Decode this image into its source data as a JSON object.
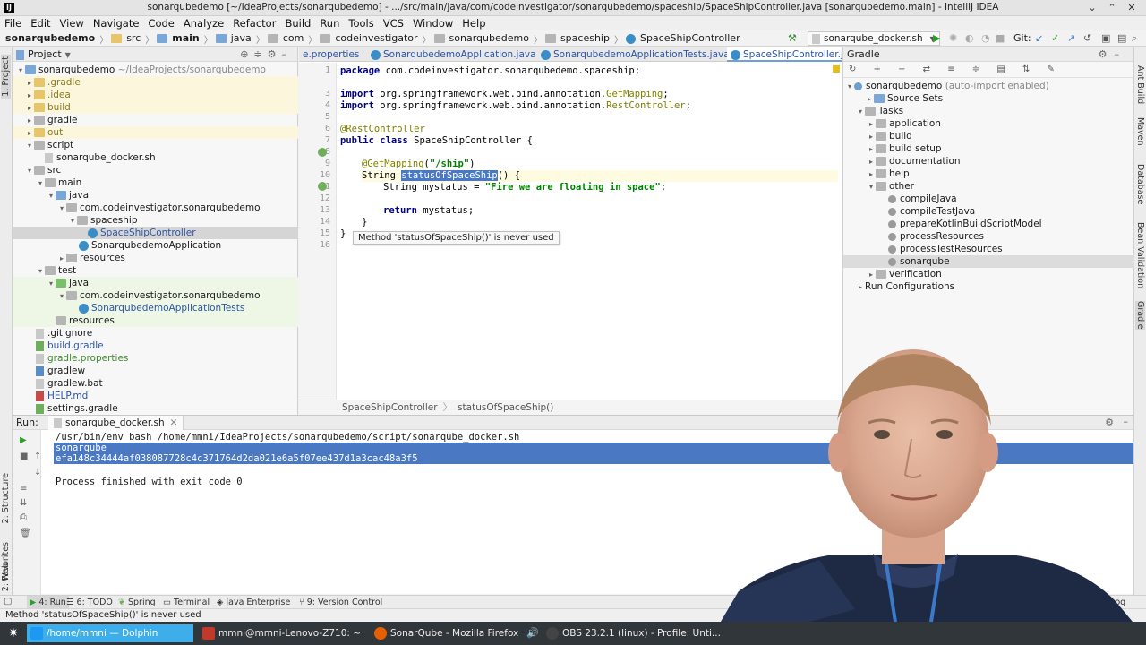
{
  "window": {
    "title": "sonarqubedemo [~/IdeaProjects/sonarqubedemo] - .../src/main/java/com/codeinvestigator/sonarqubedemo/spaceship/SpaceShipController.java [sonarqubedemo.main] - IntelliJ IDEA"
  },
  "menu": [
    "File",
    "Edit",
    "View",
    "Navigate",
    "Code",
    "Analyze",
    "Refactor",
    "Build",
    "Run",
    "Tools",
    "VCS",
    "Window",
    "Help"
  ],
  "breadcrumb": [
    "sonarqubedemo",
    "src",
    "main",
    "java",
    "com",
    "codeinvestigator",
    "sonarqubedemo",
    "spaceship",
    "SpaceShipController"
  ],
  "run_config": "sonarqube_docker.sh",
  "vcs_label": "Git:",
  "project_panel": {
    "title": "Project",
    "tree": [
      {
        "label": "sonarqubedemo",
        "suffix": "~/IdeaProjects/sonarqubedemo",
        "arrow": "▾"
      },
      {
        "label": ".gradle",
        "arrow": "▸"
      },
      {
        "label": ".idea",
        "arrow": "▸"
      },
      {
        "label": "build",
        "arrow": "▸"
      },
      {
        "label": "gradle",
        "arrow": "▸"
      },
      {
        "label": "out",
        "arrow": "▸"
      },
      {
        "label": "script",
        "arrow": "▾"
      },
      {
        "label": "sonarqube_docker.sh",
        "arrow": ""
      },
      {
        "label": "src",
        "arrow": "▾"
      },
      {
        "label": "main",
        "arrow": "▾"
      },
      {
        "label": "java",
        "arrow": "▾"
      },
      {
        "label": "com.codeinvestigator.sonarqubedemo",
        "arrow": "▾"
      },
      {
        "label": "spaceship",
        "arrow": "▾"
      },
      {
        "label": "SpaceShipController",
        "arrow": ""
      },
      {
        "label": "SonarqubedemoApplication",
        "arrow": ""
      },
      {
        "label": "resources",
        "arrow": "▸"
      },
      {
        "label": "test",
        "arrow": "▾"
      },
      {
        "label": "java",
        "arrow": "▾"
      },
      {
        "label": "com.codeinvestigator.sonarqubedemo",
        "arrow": "▾"
      },
      {
        "label": "SonarqubedemoApplicationTests",
        "arrow": ""
      },
      {
        "label": "resources",
        "arrow": ""
      },
      {
        "label": ".gitignore",
        "arrow": ""
      },
      {
        "label": "build.gradle",
        "arrow": ""
      },
      {
        "label": "gradle.properties",
        "arrow": ""
      },
      {
        "label": "gradlew",
        "arrow": ""
      },
      {
        "label": "gradlew.bat",
        "arrow": ""
      },
      {
        "label": "HELP.md",
        "arrow": ""
      },
      {
        "label": "settings.gradle",
        "arrow": ""
      }
    ]
  },
  "editor": {
    "tabs": [
      "e.properties",
      "SonarqubedemoApplication.java",
      "SonarqubedemoApplicationTests.java",
      "SpaceShipController.ja"
    ],
    "line_numbers": [
      "1",
      "3",
      "4",
      "5",
      "6",
      "7",
      "8",
      "9",
      "10",
      "11",
      "12",
      "13",
      "14",
      "15",
      "16"
    ],
    "code": {
      "l1_kw": "package",
      "l1_rest": " com.codeinvestigator.sonarqubedemo.spaceship;",
      "l3_kw": "import",
      "l3_a": " org.springframework.web.bind.annotation.",
      "l3_b": "GetMapping",
      "l3_c": ";",
      "l4_kw": "import",
      "l4_a": " org.springframework.web.bind.annotation.",
      "l4_b": "RestController",
      "l4_c": ";",
      "l6_an": "@RestController",
      "l7_kw1": "public class",
      "l7_rest": " SpaceShipController {",
      "l9_an": "@GetMapping",
      "l9_a": "(",
      "l9_str": "\"/ship\"",
      "l9_b": ")",
      "l10_a": "String ",
      "l10_sel": "statusOfSpaceShip",
      "l10_b": "() {",
      "l11_a": "String mystatus = ",
      "l11_str": "\"Fire we are floating in space\"",
      "l11_b": ";",
      "l13_kw": "return",
      "l13_rest": " mystatus;",
      "l14": "}",
      "l15": "}"
    },
    "tooltip": "Method 'statusOfSpaceShip()' is never used",
    "bottom_breadcrumb": [
      "SpaceShipController",
      "statusOfSpaceShip()"
    ]
  },
  "gradle_panel": {
    "title": "Gradle",
    "tree": [
      {
        "label": "sonarqubedemo",
        "suffix": "(auto-import enabled)",
        "arrow": "▾"
      },
      {
        "label": "Source Sets",
        "arrow": "▸"
      },
      {
        "label": "Tasks",
        "arrow": "▾"
      },
      {
        "label": "application",
        "arrow": "▸"
      },
      {
        "label": "build",
        "arrow": "▸"
      },
      {
        "label": "build setup",
        "arrow": "▸"
      },
      {
        "label": "documentation",
        "arrow": "▸"
      },
      {
        "label": "help",
        "arrow": "▸"
      },
      {
        "label": "other",
        "arrow": "▾"
      },
      {
        "label": "compileJava",
        "arrow": ""
      },
      {
        "label": "compileTestJava",
        "arrow": ""
      },
      {
        "label": "prepareKotlinBuildScriptModel",
        "arrow": ""
      },
      {
        "label": "processResources",
        "arrow": ""
      },
      {
        "label": "processTestResources",
        "arrow": ""
      },
      {
        "label": "sonarqube",
        "arrow": ""
      },
      {
        "label": "verification",
        "arrow": "▸"
      },
      {
        "label": "Run Configurations",
        "arrow": "▸"
      }
    ]
  },
  "run_panel": {
    "label": "Run:",
    "tab": "sonarqube_docker.sh",
    "console": [
      "/usr/bin/env bash /home/mmni/IdeaProjects/sonarqubedemo/script/sonarqube_docker.sh",
      "sonarqube",
      "efa148c34444af038087728c4c371764d2da021e6a5f07ee437d1a3cac48a3f5",
      "",
      "Process finished with exit code 0"
    ]
  },
  "left_stripe": [
    "1: Project",
    "2: Structure",
    "2: Favorites",
    "Web"
  ],
  "right_stripe": [
    "Ant Build",
    "Maven",
    "Database",
    "Bean Validation",
    "Gradle"
  ],
  "bottom_tabs": [
    "4: Run",
    "6: TODO",
    "Spring",
    "Terminal",
    "Java Enterprise",
    "9: Version Control",
    "Event Log"
  ],
  "status_text": "Method 'statusOfSpaceShip()' is never used",
  "taskbar": [
    "/home/mmni — Dolphin",
    "mmni@mmni-Lenovo-Z710: ~",
    "SonarQube - Mozilla Firefox",
    "OBS 23.2.1 (linux) - Profile: Unti..."
  ],
  "colors": {
    "selection": "#4a78c2",
    "taskbar": "#31363b",
    "accent": "#3daee9"
  }
}
